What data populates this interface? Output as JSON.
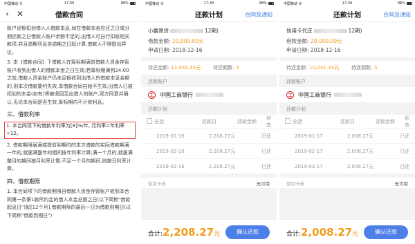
{
  "status": {
    "left": {
      "carrier": "中国移动 令",
      "time": "17:39",
      "battery": "88%"
    },
    "mid": {
      "carrier": "中国移动 令",
      "time": "17:39",
      "battery": "88%"
    },
    "right": {
      "carrier": "中国移动 令",
      "time": "17:39",
      "battery": "88%"
    }
  },
  "contract": {
    "back": "‹",
    "close": "✕",
    "title": "借款合同",
    "paras": [
      "账户足额扣划借入人借款本息,如在借款本金应还之日或分期还款之日借款人账户余额不足的,出借人可自行扣收相关款项,并且逾期罚息自逾期之日起计算,借款人不得提出异议。",
      "3. 本《借款合同》下借款人在筹标期满前借款人资金存管账户收到出借人的借款本金之日生效;若筹标期满到24:00之前,借款人资金账户仍未足额收到出借人的借款本息金额的,则本次借款要约失效,本借款合同自始不生效,出借人已被扣划的本金(如有)将被退回至出借人的账户,双方同意并确认,无论本合同是否生效,筹标期内不计收利息。"
    ],
    "sec3": "三、借款利率",
    "rate_line": "1. 本合同项下的借款年利率为[8]%/年, 月利率=年利率÷12。",
    "para_after_rate": "2. 借款期限届满或提前到期时的本次借款的实际借款期满一年的,就届满整年的期间按年利率计算;满一个月的,就届满整月的期间按月利率计算;不足一个月的期间,则按日利率计算。",
    "sec4": "四、借款期限",
    "para_term": "1. 本合同项下的借款期限自借款人资金存管账户收到本合同第一条第1款所约定的借入本金总额之日(以下简称\"借款起息日\")起[12个月],借款期限的最后一日为借款到期日(以下简称\"借款到期日\")"
  },
  "plan_mid": {
    "title": "还款计划",
    "link": "合同及通知",
    "name_prefix": "小赢易贷",
    "name_suffix": "12期)",
    "amount_label": "借款金额:",
    "amount": "20,000.00元",
    "date_label": "申请日期:",
    "date": "2018-12-16",
    "due_label": "待还金额:",
    "due": "11,041.33元",
    "periods_label": "待还期数:",
    "periods": "5",
    "account_label": "还款账户",
    "bank": "中国工商银行",
    "plan_label": "还款计划",
    "headers": [
      "全选",
      "还款日",
      "还款金额",
      "状态"
    ],
    "rows": [
      {
        "date": "2019-01-16",
        "amount": "2,208.27元",
        "status": "已还"
      },
      {
        "date": "2019-02-16",
        "amount": "2,208.27元",
        "status": "已还"
      },
      {
        "date": "2019-03-16",
        "amount": "2,208.27元",
        "status": "已还"
      }
    ],
    "card_label": "使用卡券",
    "card_value": "无可用",
    "total_label": "合计:",
    "total": "2,208.27",
    "total_unit": "元",
    "pay": "确认还款"
  },
  "plan_right": {
    "title": "还款计划",
    "link": "合同及通知",
    "name_prefix": "信用卡代还",
    "name_suffix": "12期)",
    "amount_label": "借款金额:",
    "amount": "20,000.00元",
    "date_label": "申请日期:",
    "date": "2018-12-16",
    "due_label": "待还金额:",
    "due": "10,041.33元",
    "periods_label": "待还期数:",
    "periods": "5",
    "account_label": "还款账户",
    "bank": "中国工商银行",
    "plan_label": "还款计划",
    "headers": [
      "全选",
      "还款日",
      "还款金额",
      "状态"
    ],
    "rows": [
      {
        "date": "2019-01-17",
        "amount": "2,008.27元",
        "status": "已还"
      },
      {
        "date": "2019-02-17",
        "amount": "2,008.27元",
        "status": "已还"
      },
      {
        "date": "2019-03-17",
        "amount": "2,008.27元",
        "status": "已还"
      }
    ],
    "card_label": "使用卡券",
    "card_value": "无可用",
    "total_label": "合计:",
    "total": "2,008.27",
    "total_unit": "元",
    "pay": "确认还款"
  },
  "colors": {
    "accent": "#4d7fe8",
    "amount": "#f39b1a",
    "highlight_border": "#e8423a",
    "bank_red": "#d2231d"
  }
}
